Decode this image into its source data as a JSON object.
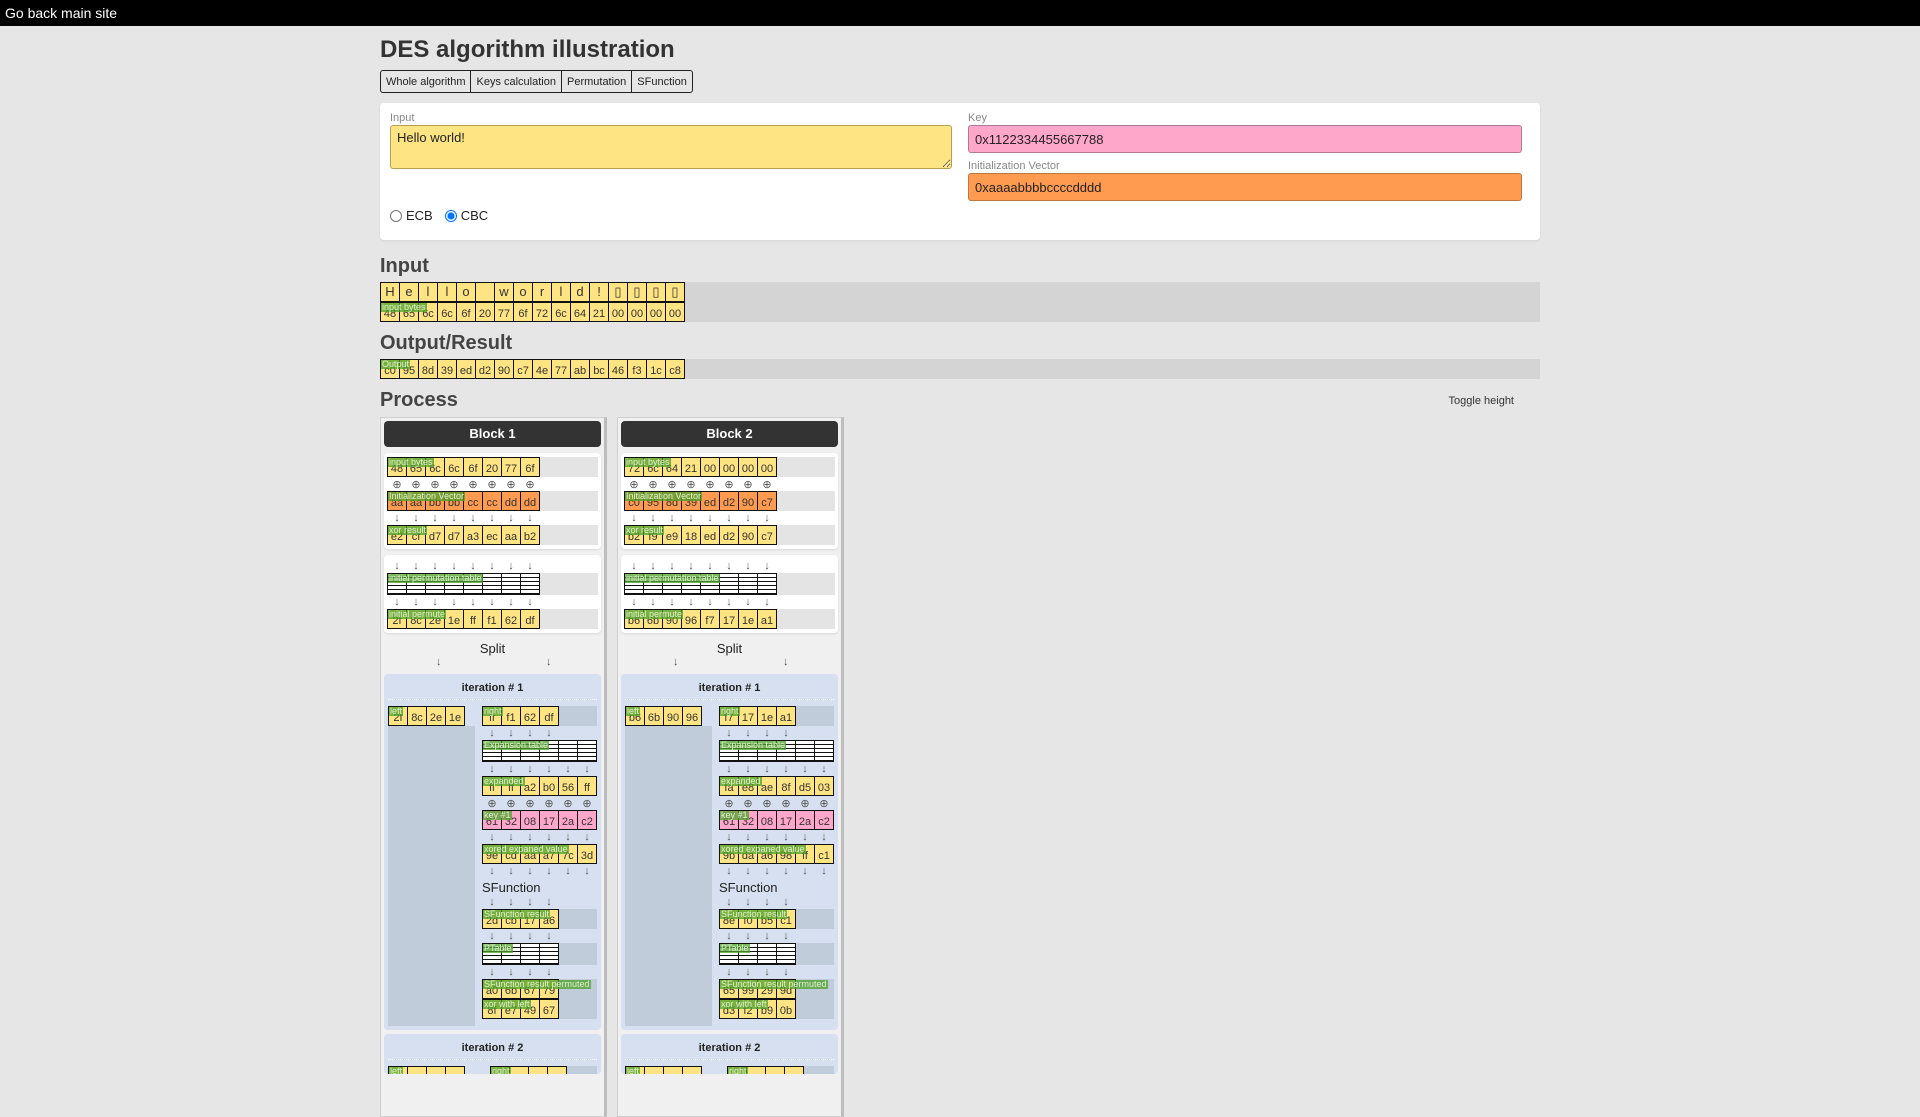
{
  "topbar": {
    "back_link": "Go back main site"
  },
  "title": "DES algorithm illustration",
  "nav": [
    "Whole algorithm",
    "Keys calculation",
    "Permutation",
    "SFunction"
  ],
  "form": {
    "input_label": "Input",
    "input_value": "Hello world!",
    "key_label": "Key",
    "key_value": "0x1122334455667788",
    "iv_label": "Initialization Vector",
    "iv_value": "0xaaaabbbbccccdddd",
    "modes": [
      {
        "label": "ECB",
        "checked": false
      },
      {
        "label": "CBC",
        "checked": true
      }
    ]
  },
  "input_section": {
    "heading": "Input",
    "chars": [
      "H",
      "e",
      "l",
      "l",
      "o",
      " ",
      "w",
      "o",
      "r",
      "l",
      "d",
      "!",
      "▯",
      "▯",
      "▯",
      "▯"
    ],
    "bytes_tag": "input bytes",
    "bytes": [
      "48",
      "65",
      "6c",
      "6c",
      "6f",
      "20",
      "77",
      "6f",
      "72",
      "6c",
      "64",
      "21",
      "00",
      "00",
      "00",
      "00"
    ]
  },
  "output_section": {
    "heading": "Output/Result",
    "tag": "Output",
    "bytes": [
      "c0",
      "95",
      "8d",
      "39",
      "ed",
      "d2",
      "90",
      "c7",
      "4e",
      "77",
      "ab",
      "bc",
      "46",
      "f3",
      "1c",
      "c8"
    ]
  },
  "process": {
    "heading": "Process",
    "toggle_label": "Toggle height",
    "split_label": "Split",
    "sfunction_label": "SFunction",
    "tags": {
      "input_bytes": "input bytes",
      "iv": "Initialization Vector",
      "xor_result": "xor result",
      "ip_table": "initial permutation table",
      "initial_permute": "initial permute",
      "left": "left",
      "right": "right",
      "expansion": "Expansion table",
      "expanded": "expanded",
      "key1": "key #1",
      "xored": "xored expaned value",
      "sfn_result": "SFunction result",
      "ptable": "PTable",
      "sfn_permuted": "SFunction result permuted",
      "xor_left": "xor with left"
    },
    "blocks": [
      {
        "title": "Block 1",
        "input": [
          "48",
          "65",
          "6c",
          "6c",
          "6f",
          "20",
          "77",
          "6f"
        ],
        "iv": [
          "aa",
          "aa",
          "bb",
          "bb",
          "cc",
          "cc",
          "dd",
          "dd"
        ],
        "xor": [
          "e2",
          "cf",
          "d7",
          "d7",
          "a3",
          "ec",
          "aa",
          "b2"
        ],
        "permuted": [
          "2f",
          "8c",
          "2e",
          "1e",
          "ff",
          "f1",
          "62",
          "df"
        ],
        "iterations": [
          {
            "title": "iteration # 1",
            "left": [
              "2f",
              "8c",
              "2e",
              "1e"
            ],
            "right": [
              "ff",
              "f1",
              "62",
              "df"
            ],
            "expanded": [
              "ff",
              "ff",
              "a2",
              "b0",
              "56",
              "ff"
            ],
            "key": [
              "61",
              "32",
              "08",
              "17",
              "2a",
              "c2"
            ],
            "xored": [
              "9e",
              "cd",
              "aa",
              "a7",
              "7c",
              "3d"
            ],
            "sfn": [
              "2d",
              "cb",
              "17",
              "a6"
            ],
            "sfn_perm": [
              "a0",
              "6b",
              "67",
              "79"
            ],
            "xor_left": [
              "8f",
              "e7",
              "49",
              "67"
            ]
          },
          {
            "title": "iteration # 2"
          }
        ]
      },
      {
        "title": "Block 2",
        "input": [
          "72",
          "6c",
          "64",
          "21",
          "00",
          "00",
          "00",
          "00"
        ],
        "iv": [
          "c0",
          "95",
          "8d",
          "39",
          "ed",
          "d2",
          "90",
          "c7"
        ],
        "xor": [
          "b2",
          "f9",
          "e9",
          "18",
          "ed",
          "d2",
          "90",
          "c7"
        ],
        "permuted": [
          "b6",
          "6b",
          "90",
          "96",
          "f7",
          "17",
          "1e",
          "a1"
        ],
        "iterations": [
          {
            "title": "iteration # 1",
            "left": [
              "b6",
              "6b",
              "90",
              "96"
            ],
            "right": [
              "f7",
              "17",
              "1e",
              "a1"
            ],
            "expanded": [
              "fa",
              "e8",
              "ae",
              "8f",
              "d5",
              "03"
            ],
            "key": [
              "61",
              "32",
              "08",
              "17",
              "2a",
              "c2"
            ],
            "xored": [
              "9b",
              "da",
              "a6",
              "98",
              "ff",
              "c1"
            ],
            "sfn": [
              "8e",
              "f0",
              "b5",
              "c1"
            ],
            "sfn_perm": [
              "65",
              "99",
              "29",
              "9d"
            ],
            "xor_left": [
              "d3",
              "f2",
              "b9",
              "0b"
            ]
          },
          {
            "title": "iteration # 2"
          }
        ]
      }
    ]
  }
}
